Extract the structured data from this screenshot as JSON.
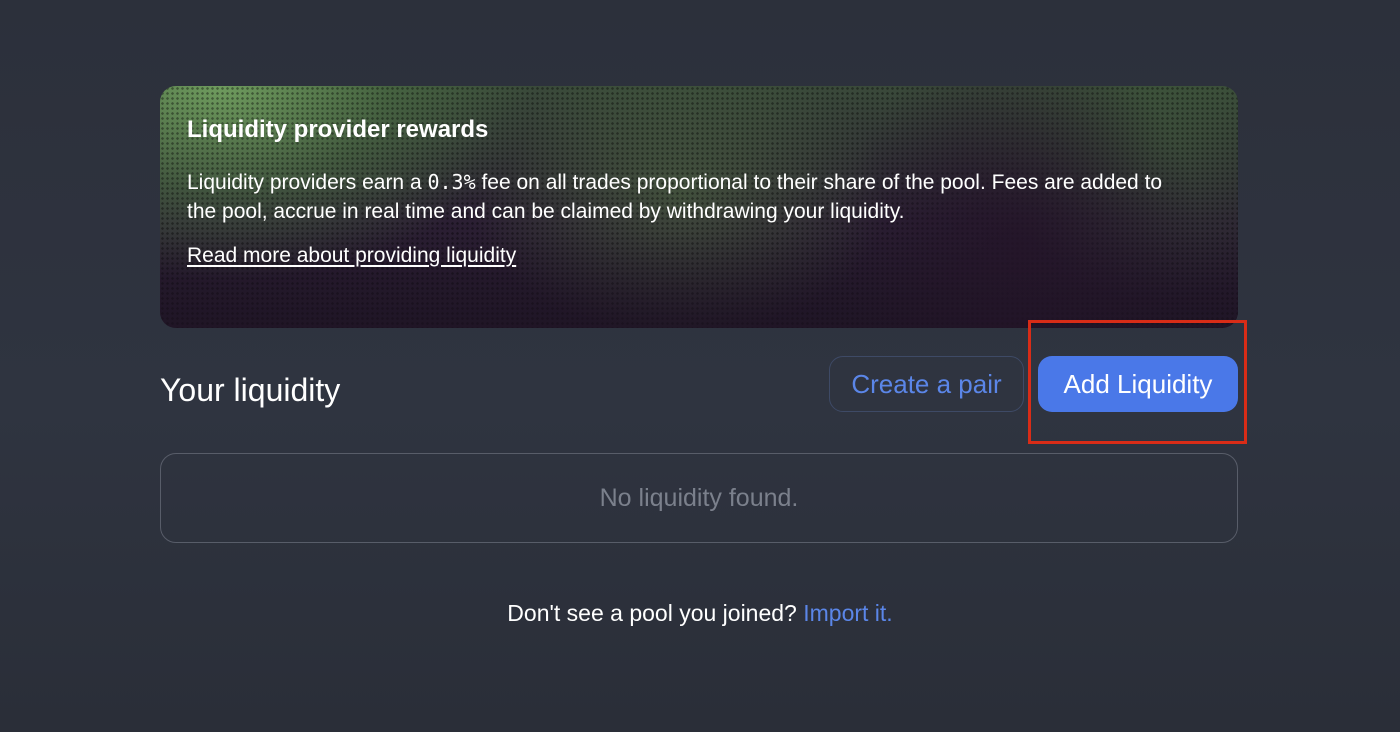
{
  "banner": {
    "title": "Liquidity provider rewards",
    "text_before_fee": "Liquidity providers earn a ",
    "fee": "0.3%",
    "text_after_fee": " fee on all trades proportional to their share of the pool. Fees are added to the pool, accrue in real time and can be claimed by withdrawing your liquidity.",
    "link": "Read more about providing liquidity"
  },
  "liquidity": {
    "title": "Your liquidity",
    "create_pair_label": "Create a pair",
    "add_liquidity_label": "Add Liquidity",
    "empty_message": "No liquidity found."
  },
  "footer": {
    "prompt": "Don't see a pool you joined? ",
    "import_link": "Import it."
  },
  "colors": {
    "background": "#2f3440",
    "accent_blue": "#4a78e8",
    "link_blue": "#5b86e8",
    "highlight_red": "#d92c17"
  }
}
